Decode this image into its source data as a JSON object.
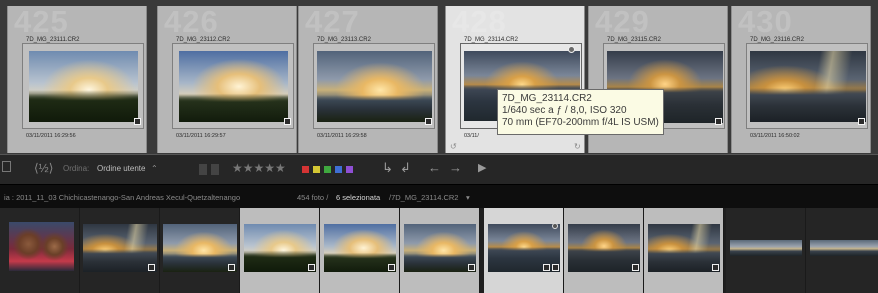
{
  "grid": {
    "cells": [
      {
        "index": "425",
        "filename": "7D_MG_23111.CR2",
        "date": "03/11/2011 16:29:56",
        "scene": "forest"
      },
      {
        "index": "426",
        "filename": "7D_MG_23112.CR2",
        "date": "03/11/2011 16:29:57",
        "scene": "forest2"
      },
      {
        "index": "427",
        "filename": "7D_MG_23113.CR2",
        "date": "03/11/2011 16:29:58",
        "scene": "valley"
      },
      {
        "index": "428",
        "filename": "7D_MG_23114.CR2",
        "date": "03/11/",
        "scene": "volcano"
      },
      {
        "index": "429",
        "filename": "7D_MG_23115.CR2",
        "date": "",
        "scene": "volcano2"
      },
      {
        "index": "430",
        "filename": "7D_MG_23116.CR2",
        "date": "03/11/2011 16:50:02",
        "scene": "rays"
      }
    ]
  },
  "tooltip": {
    "line1": "7D_MG_23114.CR2",
    "line2": "1/640 sec a ƒ / 8,0, ISO 320",
    "line3": "70 mm (EF70-200mm f/4L IS USM)"
  },
  "toolbar": {
    "sort_label": "Ordina:",
    "sort_value": "Ordine utente",
    "stars": "★★★★★",
    "color_labels": [
      "#d43434",
      "#d4c734",
      "#3fa83f",
      "#3f6fd4",
      "#8f4fd4"
    ]
  },
  "statusbar": {
    "path": "ia : 2011_11_03 Chichicastenango-San Andreas Xecul-Quetzaltenango",
    "count": "454 foto /",
    "selected": "6 selezionata",
    "current": "/7D_MG_23114.CR2"
  },
  "filmstrip": {
    "thumbs": [
      {
        "state": "dark",
        "scene": "people"
      },
      {
        "state": "dark",
        "scene": "rays"
      },
      {
        "state": "dark",
        "scene": "valley"
      },
      {
        "state": "sel",
        "scene": "forest"
      },
      {
        "state": "sel",
        "scene": "forest2"
      },
      {
        "state": "sel",
        "scene": "valley"
      },
      {
        "state": "act",
        "scene": "volcano"
      },
      {
        "state": "sel",
        "scene": "volcano2"
      },
      {
        "state": "sel",
        "scene": "rays"
      },
      {
        "state": "dark",
        "scene": "strip"
      },
      {
        "state": "dark",
        "scene": "strip"
      }
    ]
  }
}
